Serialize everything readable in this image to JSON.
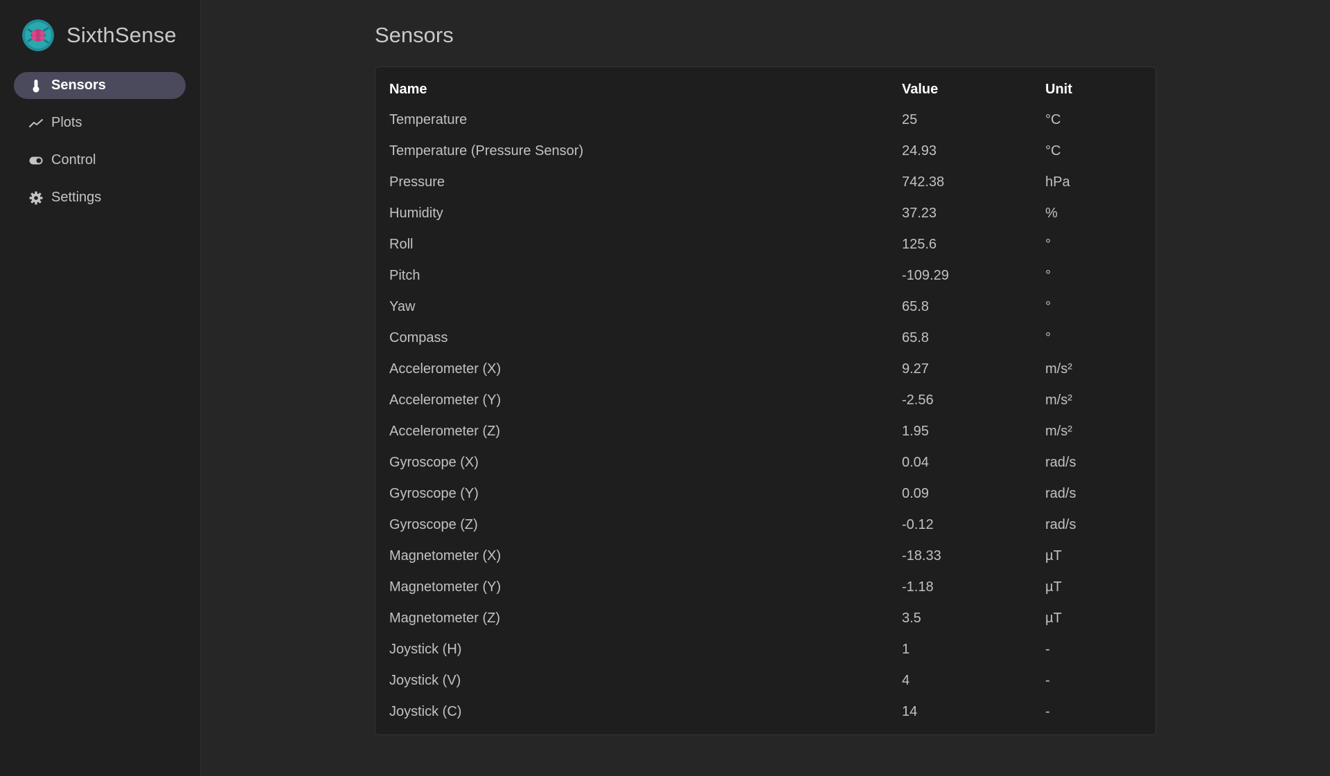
{
  "app": {
    "name": "SixthSense",
    "logo_icon": "sixthsense-logo-icon",
    "accent": "#4b4a5c"
  },
  "sidebar": {
    "items": [
      {
        "label": "Sensors",
        "icon": "thermometer-icon",
        "active": true
      },
      {
        "label": "Plots",
        "icon": "chart-line-icon",
        "active": false
      },
      {
        "label": "Control",
        "icon": "toggle-icon",
        "active": false
      },
      {
        "label": "Settings",
        "icon": "gear-icon",
        "active": false
      }
    ]
  },
  "main": {
    "title": "Sensors",
    "table": {
      "headers": [
        "Name",
        "Value",
        "Unit"
      ],
      "rows": [
        {
          "name": "Temperature",
          "value": "25",
          "unit": "°C"
        },
        {
          "name": "Temperature (Pressure Sensor)",
          "value": "24.93",
          "unit": "°C"
        },
        {
          "name": "Pressure",
          "value": "742.38",
          "unit": "hPa"
        },
        {
          "name": "Humidity",
          "value": "37.23",
          "unit": "%"
        },
        {
          "name": "Roll",
          "value": "125.6",
          "unit": "°"
        },
        {
          "name": "Pitch",
          "value": "-109.29",
          "unit": "°"
        },
        {
          "name": "Yaw",
          "value": "65.8",
          "unit": "°"
        },
        {
          "name": "Compass",
          "value": "65.8",
          "unit": "°"
        },
        {
          "name": "Accelerometer (X)",
          "value": "9.27",
          "unit": "m/s²"
        },
        {
          "name": "Accelerometer (Y)",
          "value": "-2.56",
          "unit": "m/s²"
        },
        {
          "name": "Accelerometer (Z)",
          "value": "1.95",
          "unit": "m/s²"
        },
        {
          "name": "Gyroscope (X)",
          "value": "0.04",
          "unit": "rad/s"
        },
        {
          "name": "Gyroscope (Y)",
          "value": "0.09",
          "unit": "rad/s"
        },
        {
          "name": "Gyroscope (Z)",
          "value": "-0.12",
          "unit": "rad/s"
        },
        {
          "name": "Magnetometer (X)",
          "value": "-18.33",
          "unit": "µT"
        },
        {
          "name": "Magnetometer (Y)",
          "value": "-1.18",
          "unit": "µT"
        },
        {
          "name": "Magnetometer (Z)",
          "value": "3.5",
          "unit": "µT"
        },
        {
          "name": "Joystick (H)",
          "value": "1",
          "unit": "-"
        },
        {
          "name": "Joystick (V)",
          "value": "4",
          "unit": "-"
        },
        {
          "name": "Joystick (C)",
          "value": "14",
          "unit": "-"
        }
      ]
    }
  }
}
